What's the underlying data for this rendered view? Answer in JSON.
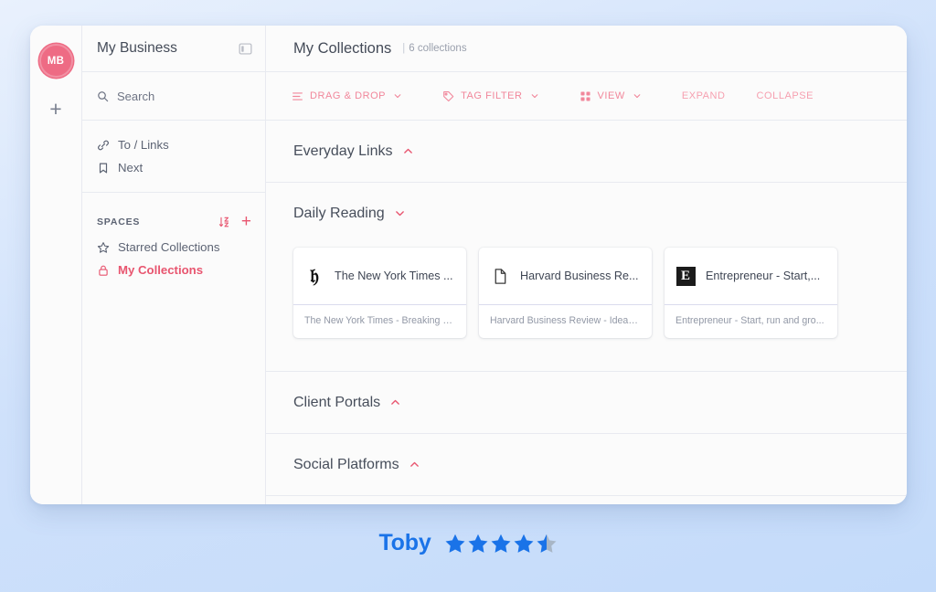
{
  "rail": {
    "avatar_initials": "MB",
    "add_label": "+"
  },
  "sidebar": {
    "title": "My Business",
    "panel_toggle_icon": "panel-toggle-icon",
    "search": {
      "placeholder": "Search",
      "value": "",
      "icon": "search-icon"
    },
    "quick_items": [
      {
        "label": "To / Links",
        "icon": "link-icon"
      },
      {
        "label": "Next",
        "icon": "bookmark-icon"
      }
    ],
    "spaces": {
      "heading": "SPACES",
      "sort_icon": "sort-alpha-down-icon",
      "add_icon": "plus-icon",
      "items": [
        {
          "label": "Starred Collections",
          "icon": "star-icon",
          "active": false
        },
        {
          "label": "My Collections",
          "icon": "lock-icon",
          "active": true
        }
      ]
    }
  },
  "main": {
    "header": {
      "title": "My Collections",
      "separator": "|",
      "count": "6 collections"
    },
    "toolbar": {
      "buttons": [
        {
          "label": "DRAG & DROP",
          "icon": "list-lines-icon",
          "caret": "chevron-down-icon"
        },
        {
          "label": "TAG FILTER",
          "icon": "tag-icon",
          "caret": "chevron-down-icon"
        },
        {
          "label": "VIEW",
          "icon": "grid-icon",
          "caret": "chevron-down-icon"
        }
      ],
      "links": [
        {
          "label": "EXPAND"
        },
        {
          "label": "COLLAPSE"
        }
      ]
    },
    "collections": [
      {
        "name": "Everyday Links",
        "state": "collapsed",
        "caret": "chevron-up-icon",
        "cards": []
      },
      {
        "name": "Daily Reading",
        "state": "expanded",
        "caret": "chevron-down-icon",
        "cards": [
          {
            "favicon": "nyt-icon",
            "title": "The New York Times ...",
            "subtitle": "The New York Times - Breaking N..."
          },
          {
            "favicon": "document-icon",
            "title": "Harvard Business Re...",
            "subtitle": "Harvard Business Review - Ideas ..."
          },
          {
            "favicon": "entrepreneur-icon",
            "title": "Entrepreneur - Start,...",
            "subtitle": "Entrepreneur - Start, run and gro..."
          }
        ]
      },
      {
        "name": "Client Portals",
        "state": "collapsed",
        "caret": "chevron-up-icon",
        "cards": []
      },
      {
        "name": "Social Platforms",
        "state": "collapsed",
        "caret": "chevron-up-icon",
        "cards": []
      }
    ]
  },
  "footer": {
    "brand": "Toby",
    "rating": 4.5,
    "stars_total": 5,
    "star_color": "#1a73e8",
    "star_empty_color": "#a8b6c6"
  },
  "colors": {
    "accent": "#e8556f",
    "accent_soft": "#f1879b",
    "window_bg": "#fbfbfb",
    "page_bg": "#cfe1fb",
    "text": "#444b58"
  }
}
